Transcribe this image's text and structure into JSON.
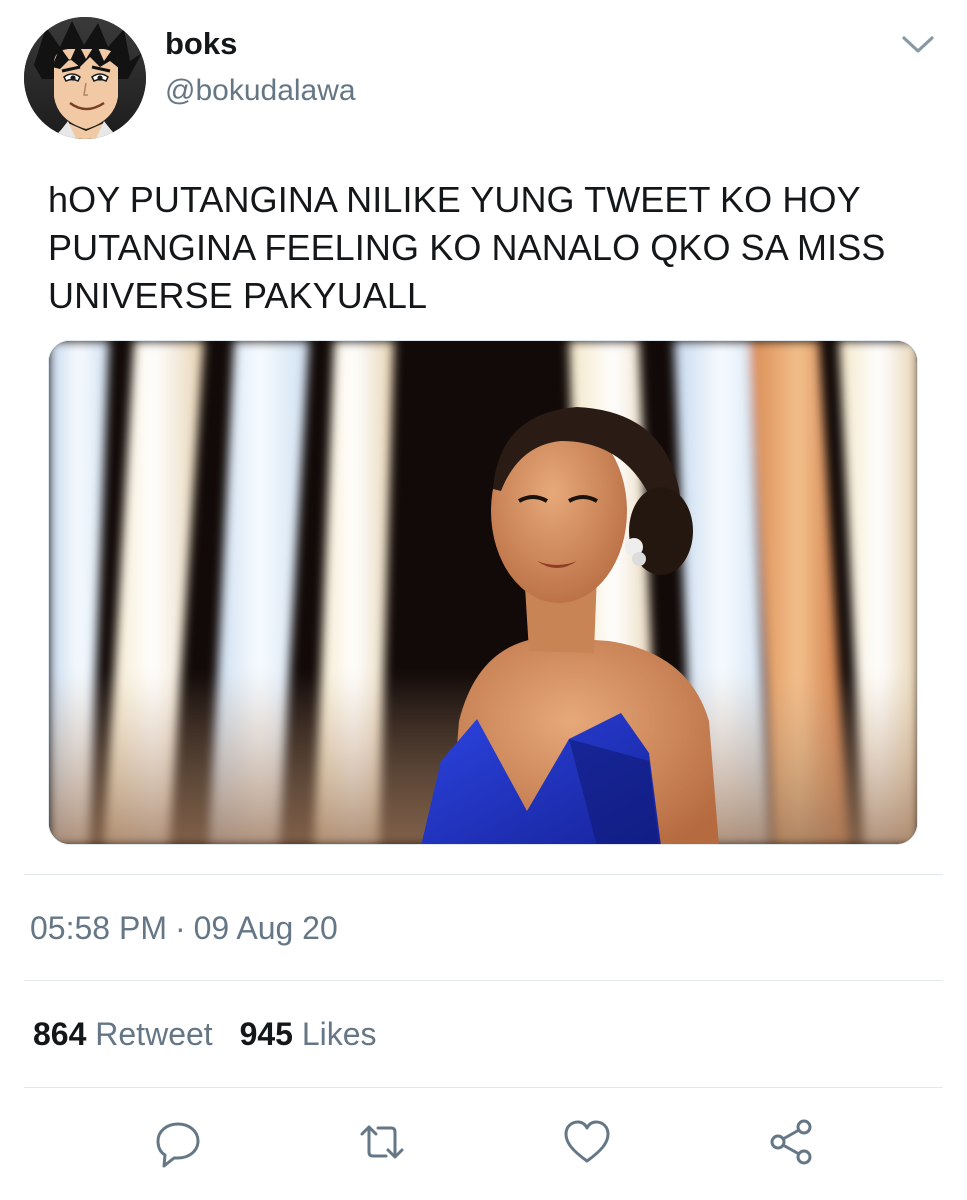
{
  "user": {
    "display_name": "boks",
    "handle": "@bokudalawa",
    "avatar_icon": "anime-character-avatar"
  },
  "tweet": {
    "text": "hOY PUTANGINA NILIKE YUNG TWEET KO HOY PUTANGINA FEELING KO NANALO QKO SA MISS UNIVERSE PAKYUALL",
    "media_icon": "photo-woman-in-blue-gown"
  },
  "meta": {
    "time": "05:58 PM",
    "separator": "·",
    "date": "09 Aug 20"
  },
  "stats": {
    "retweets_count": "864",
    "retweets_label": "Retweet",
    "likes_count": "945",
    "likes_label": "Likes"
  },
  "actions": [
    "reply-icon",
    "retweet-icon",
    "like-icon",
    "share-icon"
  ],
  "colors": {
    "text": "#14171a",
    "secondary": "#657786",
    "divider": "#e1e8ed",
    "dress_blue": "#1f35c8"
  }
}
